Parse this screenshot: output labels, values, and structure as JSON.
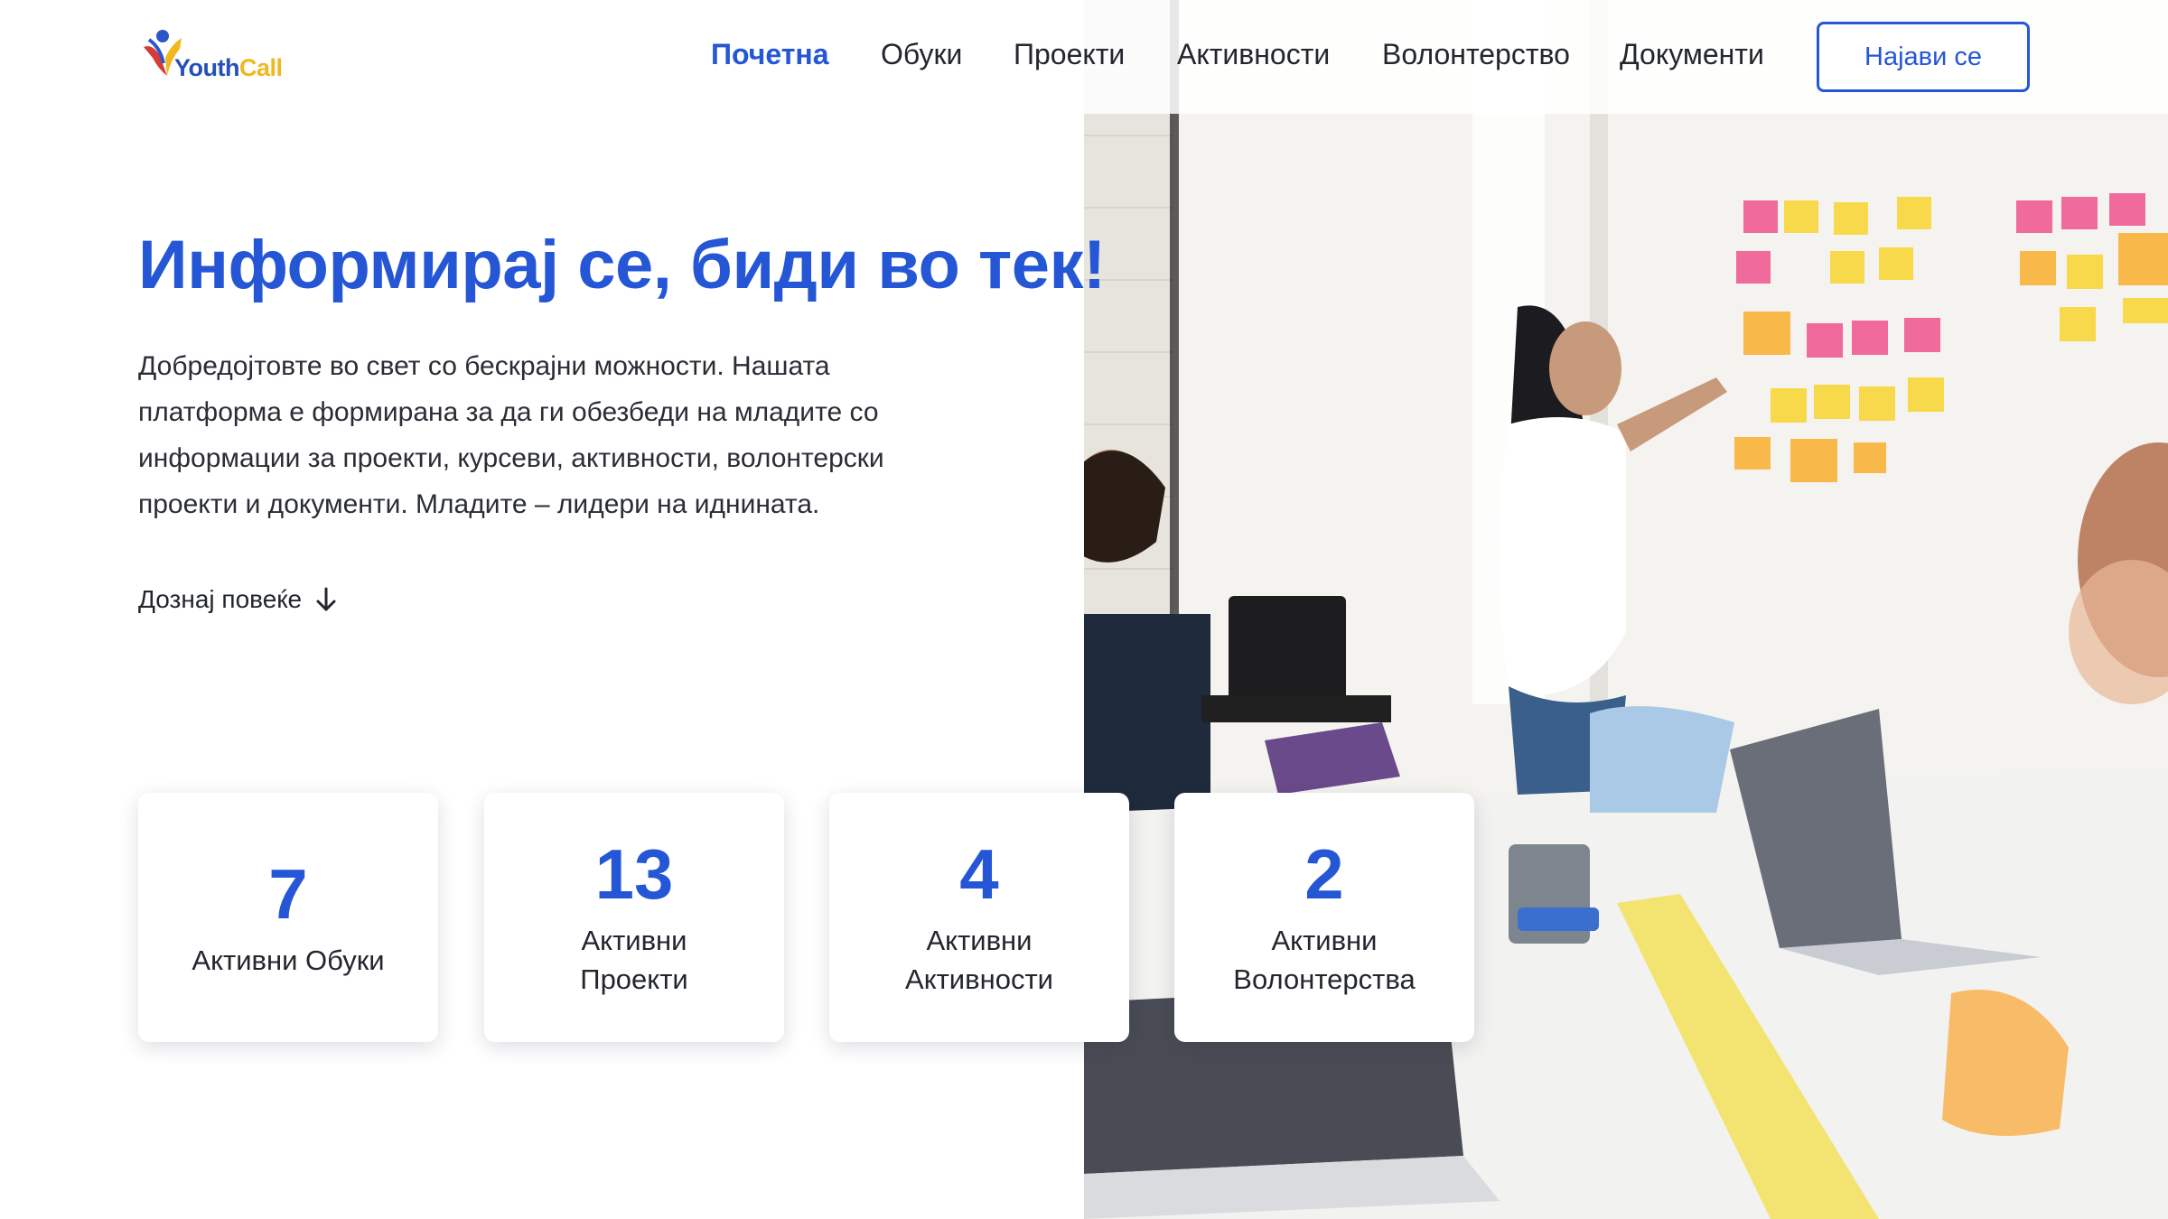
{
  "brand": {
    "logo_part1": "Youth",
    "logo_part2": "Call"
  },
  "nav": {
    "items": [
      {
        "label": "Почетна",
        "active": true
      },
      {
        "label": "Обуки",
        "active": false
      },
      {
        "label": "Проекти",
        "active": false
      },
      {
        "label": "Активности",
        "active": false
      },
      {
        "label": "Волонтерство",
        "active": false
      },
      {
        "label": "Документи",
        "active": false
      }
    ],
    "login_label": "Најави се"
  },
  "hero": {
    "title": "Информирај се, биди во тек!",
    "description": "Добредојтовте во свет со бескрајни можности. Нашата платформа е формирана за да ги обезбеди на младите со информации за проекти, курсеви, активности, волонтерски проекти и документи. Младите – лидери на иднината.",
    "learn_more": "Дознај повеќе",
    "learn_more_icon": "arrow-down-icon"
  },
  "stats": [
    {
      "value": "7",
      "label": "Активни Обуки"
    },
    {
      "value": "13",
      "label": "Активни Проекти"
    },
    {
      "value": "4",
      "label": "Активни Активности"
    },
    {
      "value": "2",
      "label": "Активни Волонтерства"
    }
  ],
  "colors": {
    "accent": "#2456d6",
    "logo_blue": "#2450b8",
    "logo_yellow": "#f2b61e",
    "text": "#23262e"
  }
}
